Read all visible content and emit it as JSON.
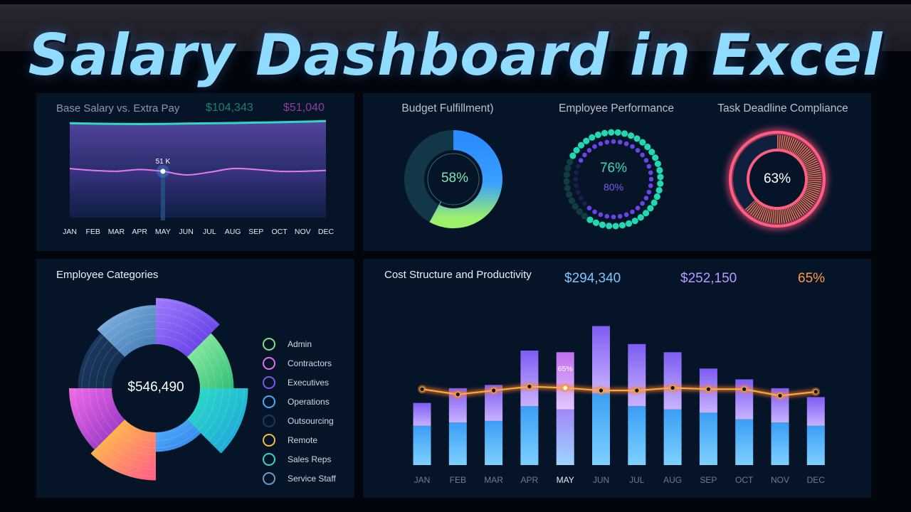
{
  "page_title": "Salary Dashboard in Excel",
  "colors": {
    "teal": "#2fd8c0",
    "pink": "#e47be6",
    "blue": "#4aa7ff",
    "purple": "#8a63f5",
    "orange": "#ff9a4a"
  },
  "salary_panel": {
    "title": "Base Salary vs. Extra Pay",
    "kpi_base": "$104,343",
    "kpi_extra": "$51,040"
  },
  "gauges": {
    "budget": {
      "title": "Budget Fulfillment)",
      "value_label": "58%"
    },
    "performance": {
      "title": "Employee Performance",
      "value_label": "76%",
      "secondary_label": "80%"
    },
    "deadline": {
      "title": "Task Deadline Compliance",
      "value_label": "63%"
    }
  },
  "categories_panel": {
    "title": "Employee Categories",
    "center_label": "$546,490"
  },
  "cost_panel": {
    "title": "Cost Structure and Productivity",
    "kpi1": "$294,340",
    "kpi2": "$252,150",
    "kpi3": "65%"
  },
  "chart_data": [
    {
      "type": "area",
      "title": "Base Salary vs. Extra Pay",
      "categories": [
        "JAN",
        "FEB",
        "MAR",
        "APR",
        "MAY",
        "JUN",
        "JUL",
        "AUG",
        "SEP",
        "OCT",
        "NOV",
        "DEC"
      ],
      "series": [
        {
          "values": [
            104,
            103.5,
            103.2,
            103,
            103.2,
            103.6,
            103.9,
            104.2,
            104.6,
            105,
            105.6,
            106.3
          ]
        },
        {
          "values": [
            54,
            52,
            51,
            53,
            51,
            47,
            50,
            54,
            53,
            51,
            51,
            52
          ]
        }
      ],
      "highlight": {
        "index": 4,
        "label": "51 K"
      },
      "ylim": [
        0,
        130
      ]
    },
    {
      "type": "pie",
      "title": "Budget Fulfillment)",
      "values": [
        58
      ]
    },
    {
      "type": "pie",
      "title": "Employee Performance",
      "series": [
        {
          "values": [
            76
          ]
        },
        {
          "values": [
            80
          ]
        }
      ]
    },
    {
      "type": "pie",
      "title": "Task Deadline Compliance",
      "values": [
        63
      ]
    },
    {
      "type": "pie",
      "title": "Employee Categories",
      "categories": [
        "Admin",
        "Contractors",
        "Executives",
        "Operations",
        "Outsourcing",
        "Remote",
        "Sales Reps",
        "Service Staff"
      ],
      "values": [
        55,
        80,
        90,
        15,
        55,
        95,
        95,
        70
      ],
      "legend": "right"
    },
    {
      "type": "bar",
      "title": "Cost Structure and Productivity",
      "categories": [
        "JAN",
        "FEB",
        "MAR",
        "APR",
        "MAY",
        "JUN",
        "JUL",
        "AUG",
        "SEP",
        "OCT",
        "NOV",
        "DEC"
      ],
      "series": [
        {
          "values": [
            12000,
            13000,
            13500,
            18000,
            17000,
            22000,
            18000,
            17000,
            16000,
            14000,
            13000,
            12000
          ]
        },
        {
          "values": [
            7000,
            10500,
            11000,
            17000,
            17500,
            20500,
            19000,
            17500,
            13500,
            12200,
            10500,
            8800
          ]
        }
      ],
      "line": {
        "values": [
          58,
          54,
          57,
          60,
          59,
          57,
          57,
          59,
          58,
          58,
          53,
          56
        ],
        "ylim": [
          0,
          100
        ],
        "highlight": {
          "index": 4,
          "label": "65%"
        }
      },
      "ylim": [
        0,
        40000
      ]
    }
  ]
}
